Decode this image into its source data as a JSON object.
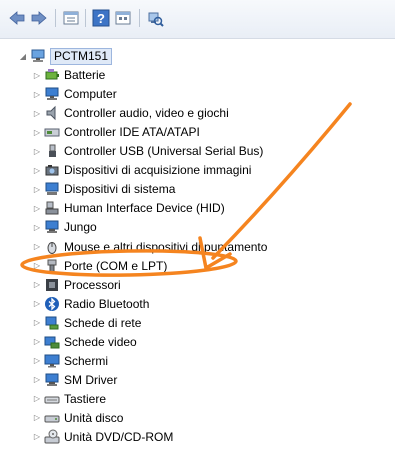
{
  "toolbar": {
    "buttons": [
      {
        "name": "back-button",
        "icon": "back-arrow-icon"
      },
      {
        "name": "forward-button",
        "icon": "forward-arrow-icon"
      },
      {
        "name": "properties-view-button",
        "icon": "properties-icon"
      },
      {
        "name": "help-button",
        "icon": "help-icon",
        "glyph": "?"
      },
      {
        "name": "view-button",
        "icon": "view-icon"
      },
      {
        "name": "scan-hardware-button",
        "icon": "scan-hardware-icon"
      }
    ]
  },
  "tree": {
    "root": {
      "label": "PCTM151",
      "icon": "computer-icon",
      "expanded": true
    },
    "items": [
      {
        "label": "Batterie",
        "icon": "battery-icon"
      },
      {
        "label": "Computer",
        "icon": "computer-icon"
      },
      {
        "label": "Controller audio, video e giochi",
        "icon": "speaker-icon"
      },
      {
        "label": "Controller IDE ATA/ATAPI",
        "icon": "disk-controller-icon"
      },
      {
        "label": "Controller USB (Universal Serial Bus)",
        "icon": "usb-icon"
      },
      {
        "label": "Dispositivi di acquisizione immagini",
        "icon": "camera-icon"
      },
      {
        "label": "Dispositivi di sistema",
        "icon": "system-device-icon"
      },
      {
        "label": "Human Interface Device (HID)",
        "icon": "hid-icon"
      },
      {
        "label": "Jungo",
        "icon": "device-icon"
      },
      {
        "label": "Mouse e altri dispositivi di puntamento",
        "icon": "mouse-icon"
      },
      {
        "label": "Porte (COM e LPT)",
        "icon": "port-icon"
      },
      {
        "label": "Processori",
        "icon": "processor-icon"
      },
      {
        "label": "Radio Bluetooth",
        "icon": "bluetooth-icon"
      },
      {
        "label": "Schede di rete",
        "icon": "network-card-icon"
      },
      {
        "label": "Schede video",
        "icon": "display-adapter-icon"
      },
      {
        "label": "Schermi",
        "icon": "monitor-icon"
      },
      {
        "label": "SM Driver",
        "icon": "device-icon"
      },
      {
        "label": "Tastiere",
        "icon": "keyboard-icon"
      },
      {
        "label": "Unità disco",
        "icon": "disk-drive-icon"
      },
      {
        "label": "Unità DVD/CD-ROM",
        "icon": "dvd-drive-icon"
      }
    ]
  },
  "annotation": {
    "color": "#f5841f",
    "highlighted_item": "Porte (COM e LPT)"
  }
}
